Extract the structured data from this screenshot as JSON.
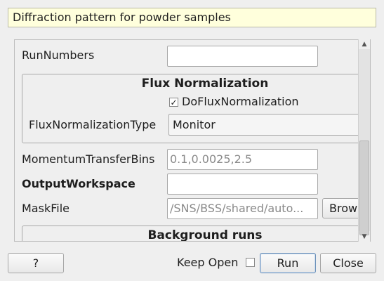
{
  "description": "Diffraction pattern for powder samples",
  "fields": {
    "run_numbers": {
      "label": "RunNumbers",
      "value": ""
    },
    "momentum": {
      "label": "MomentumTransferBins",
      "placeholder": "0.1,0.0025,2.5"
    },
    "output_workspace": {
      "label": "OutputWorkspace",
      "value": ""
    },
    "mask_file": {
      "label": "MaskFile",
      "placeholder": "/SNS/BSS/shared/auto...",
      "browse_label": "Browse"
    }
  },
  "flux_group": {
    "title": "Flux Normalization",
    "checkbox_label": "DoFluxNormalization",
    "checkbox_checked": true,
    "checkmark": "✓",
    "type_label": "FluxNormalizationType",
    "type_value": "Monitor"
  },
  "background_group": {
    "title": "Background runs"
  },
  "scrollbar": {
    "up_arrow": "▲",
    "down_arrow": "▼"
  },
  "footer": {
    "help_label": "?",
    "keep_open_label": "Keep Open",
    "keep_open_checked": false,
    "run_label": "Run",
    "close_label": "Close"
  }
}
